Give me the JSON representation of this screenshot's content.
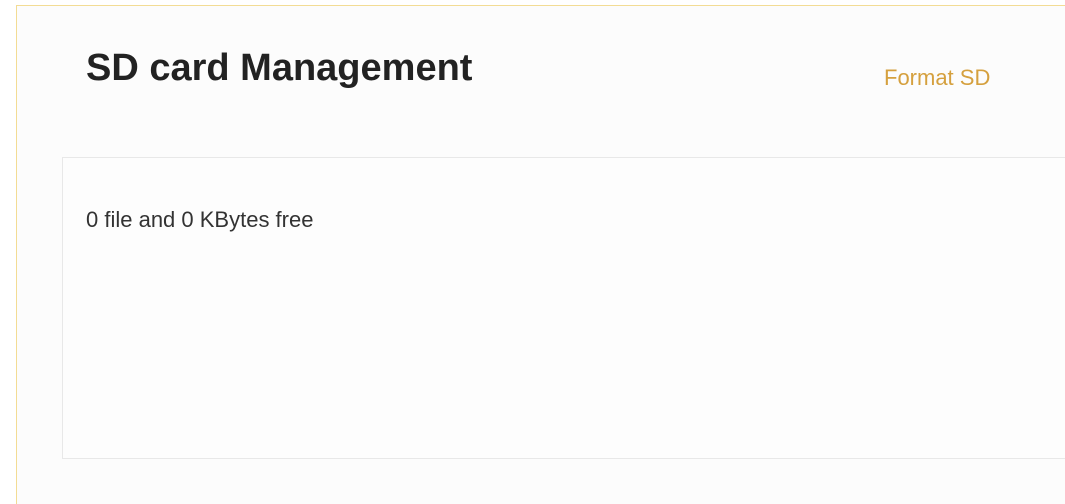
{
  "header": {
    "title": "SD card Management",
    "format_label": "Format SD"
  },
  "panel": {
    "status_text": "0 file and 0 KBytes free"
  },
  "colors": {
    "accent": "#d5a03e",
    "frame_border": "#f3dc94"
  }
}
